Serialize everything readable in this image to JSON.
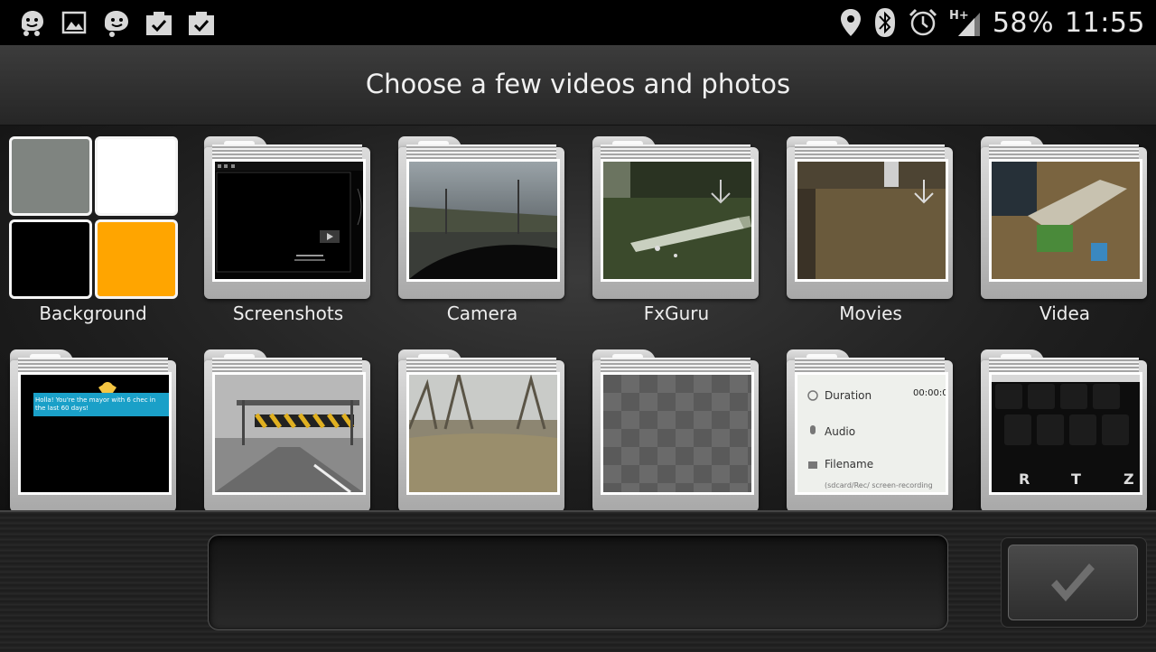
{
  "status_bar": {
    "left_icons": [
      "waze-icon",
      "gallery-icon",
      "waze-icon",
      "task-check-icon",
      "task-check-icon"
    ],
    "right_icons": [
      "location-pin-icon",
      "bluetooth-icon",
      "alarm-icon",
      "signal-hplus-icon"
    ],
    "battery": "58%",
    "time": "11:55"
  },
  "header": {
    "title": "Choose a few videos and photos"
  },
  "folders_row1": [
    {
      "label": "Background",
      "type": "color-swatches",
      "swatches": [
        "#7f8480",
        "#ffffff",
        "#000000",
        "#ffa500"
      ]
    },
    {
      "label": "Screenshots",
      "thumb": "dark-screen"
    },
    {
      "label": "Camera",
      "thumb": "road-sky"
    },
    {
      "label": "FxGuru",
      "thumb": "green-floor"
    },
    {
      "label": "Movies",
      "thumb": "brown-floor"
    },
    {
      "label": "Videa",
      "thumb": "toys"
    }
  ],
  "folders_row2": [
    {
      "label": "",
      "thumb": "mayor-notification",
      "text": "Holla! You're the mayor with 6 chec in the last 60 days!"
    },
    {
      "label": "",
      "thumb": "highway-bw"
    },
    {
      "label": "",
      "thumb": "trees"
    },
    {
      "label": "",
      "thumb": "checker"
    },
    {
      "label": "",
      "thumb": "settings-list",
      "items": [
        "Duration",
        "Audio",
        "Filename"
      ],
      "value": "00:00:0",
      "path": "(sdcard/Rec/ screen-recording"
    },
    {
      "label": "",
      "thumb": "keyboard",
      "keys": [
        "R",
        "T",
        "Z"
      ]
    }
  ],
  "colors": {
    "accent": "#ffa500",
    "text": "#eeeeee"
  },
  "done_icon": "checkmark-icon"
}
